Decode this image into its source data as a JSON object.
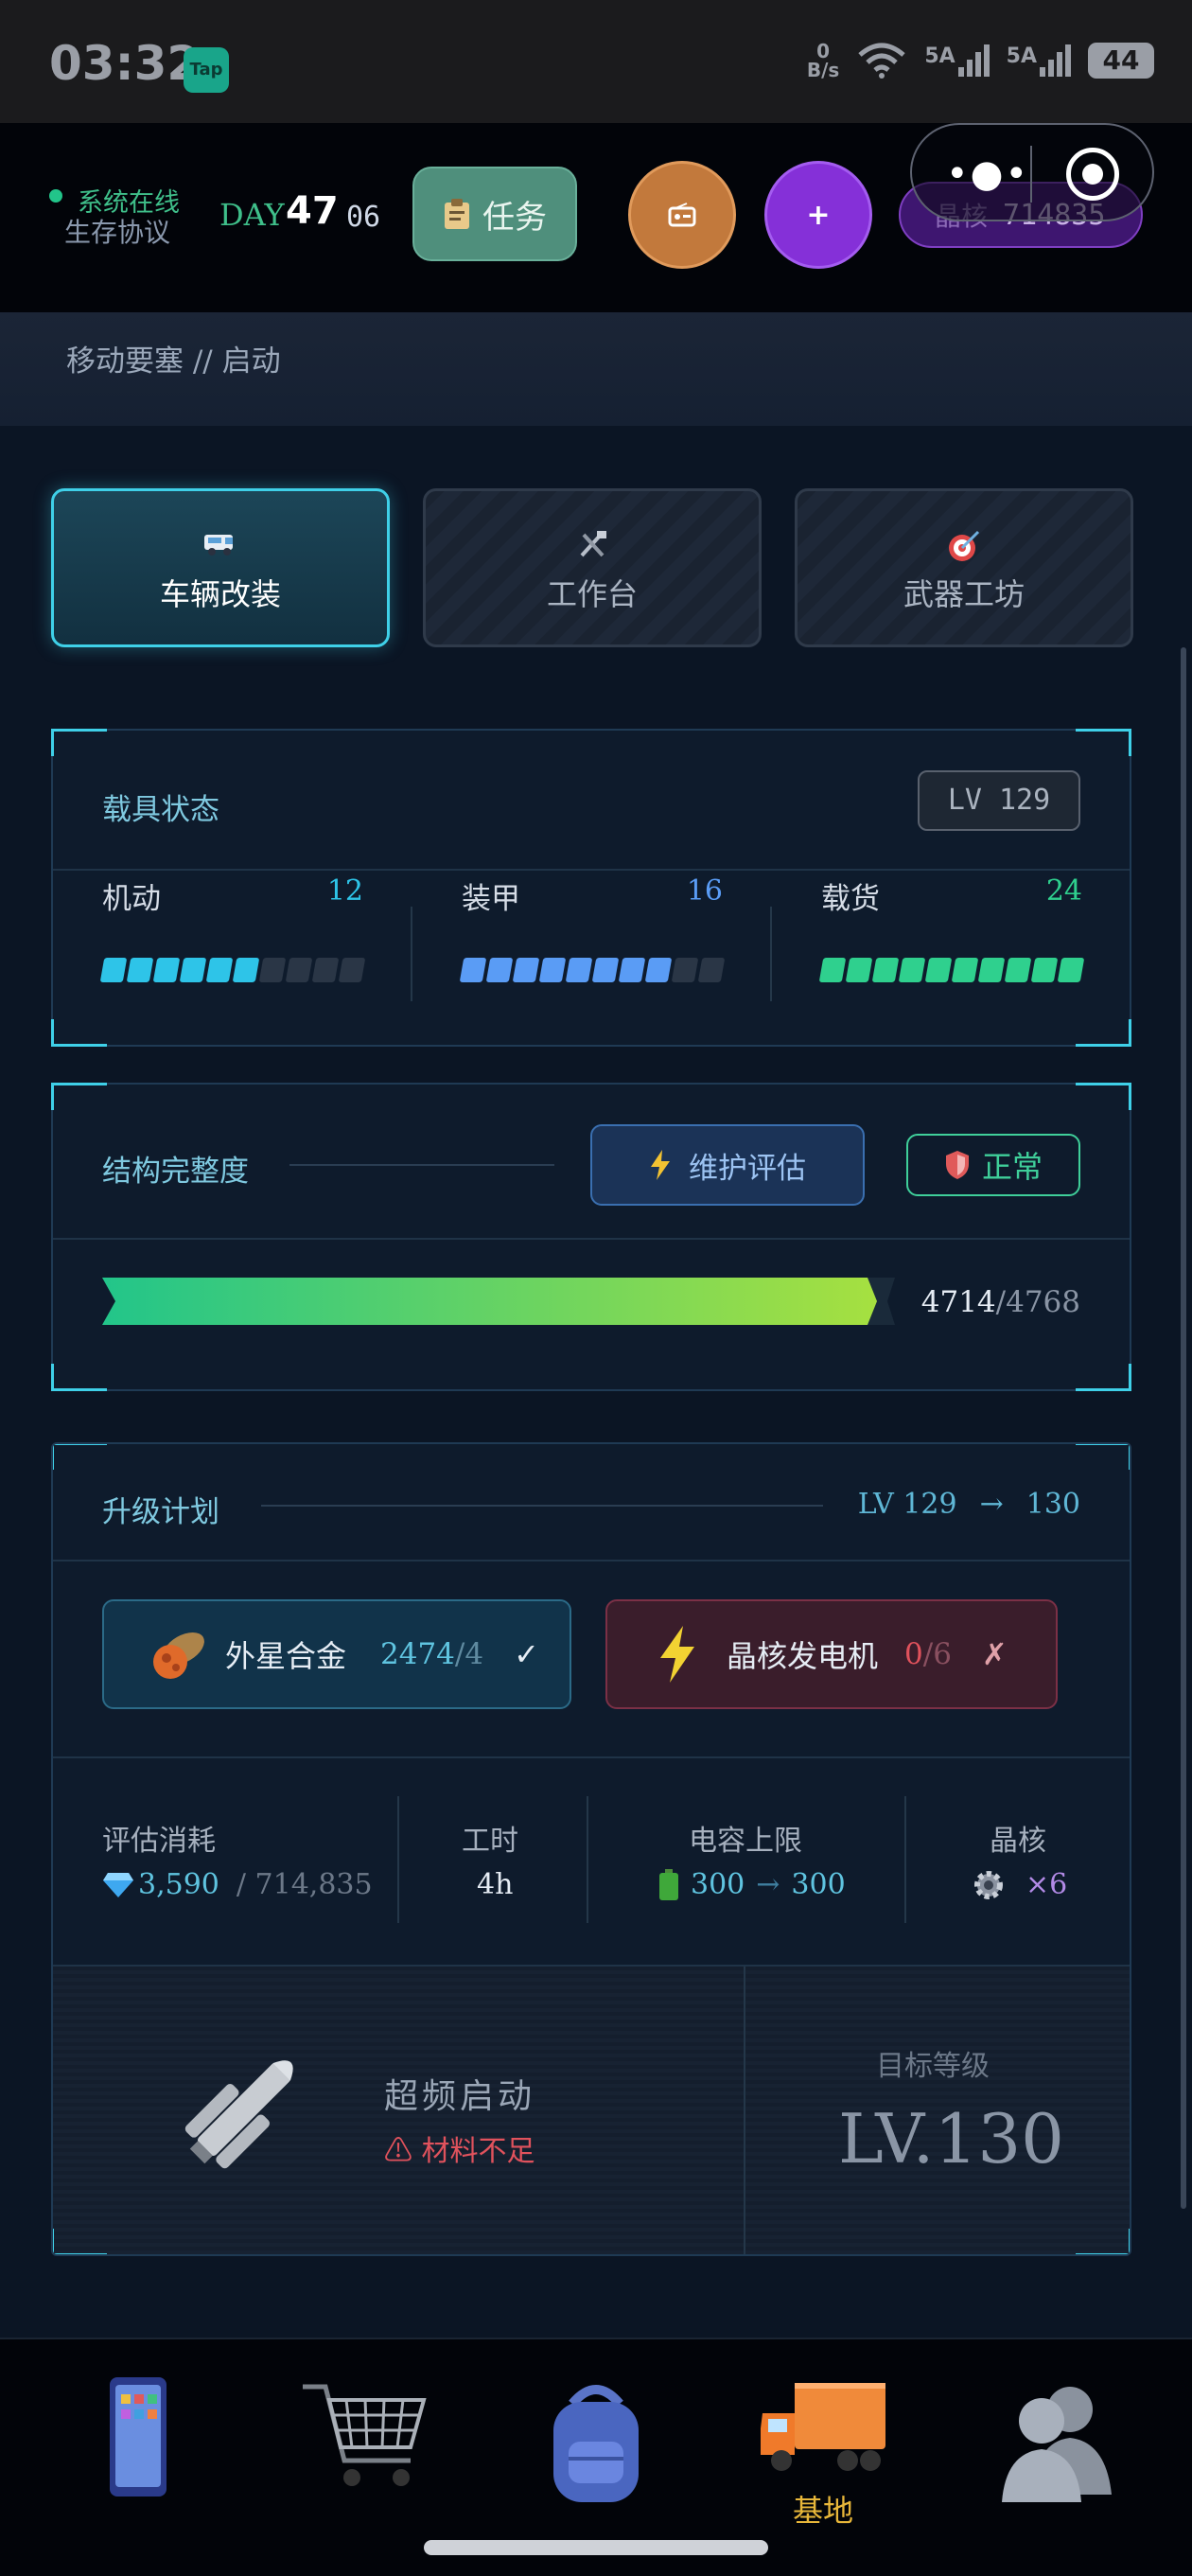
{
  "status_bar": {
    "time": "03:32",
    "app_badge": "Tap",
    "net_speed_value": "0",
    "net_speed_unit": "B/s",
    "signal_1": "5A",
    "signal_2": "5A",
    "battery": "44"
  },
  "header": {
    "system_status": "系统在线",
    "protocol": "生存协议",
    "day_label": "DAY",
    "day_number": "47",
    "day_sub": "06",
    "task_button": "任务",
    "plus_button": "+",
    "crystal_label": "晶核",
    "crystal_value": "714835"
  },
  "banner": {
    "subtitle": "移动要塞 // 启动"
  },
  "tabs": [
    {
      "label": "车辆改装",
      "icon": "van-icon",
      "active": true
    },
    {
      "label": "工作台",
      "icon": "tools-icon",
      "active": false
    },
    {
      "label": "武器工坊",
      "icon": "target-icon",
      "active": false
    }
  ],
  "vehicle_status": {
    "title": "载具状态",
    "level": "LV 129",
    "stats": [
      {
        "name": "机动",
        "value": "12",
        "filled": 6,
        "total": 10,
        "color": "#2ec4e8"
      },
      {
        "name": "装甲",
        "value": "16",
        "filled": 8,
        "total": 10,
        "color": "#5a9cf5"
      },
      {
        "name": "载货",
        "value": "24",
        "filled": 10,
        "total": 10,
        "color": "#2fd08e"
      }
    ]
  },
  "integrity": {
    "title": "结构完整度",
    "maintain_button": "维护评估",
    "status": "正常",
    "current": "4714",
    "max": "/4768",
    "fraction": 0.9886
  },
  "upgrade": {
    "title": "升级计划",
    "from_level": "LV 129",
    "arrow": "→",
    "to_level": "130",
    "requirements": [
      {
        "name": "外星合金",
        "have": "2474",
        "need": "/4",
        "mark": "✓",
        "ok": true
      },
      {
        "name": "晶核发电机",
        "have": "0",
        "need": "/6",
        "mark": "✗",
        "ok": false
      }
    ],
    "costs": {
      "estimate_label": "评估消耗",
      "estimate_value": "3,590",
      "estimate_total": "/ 714,835",
      "time_label": "工时",
      "time_value": "4h",
      "capacity_label": "电容上限",
      "capacity_from": "300",
      "capacity_arrow": "→",
      "capacity_to": "300",
      "core_label": "晶核",
      "core_value": "×6"
    },
    "launch_title": "超频启动",
    "launch_warning": "⚠ 材料不足",
    "target_label": "目标等级",
    "target_value": "LV.130"
  },
  "nav": {
    "active_label": "基地"
  },
  "colors": {
    "accent": "#3fd0e8",
    "success": "#3fcf9a",
    "danger": "#e0525c",
    "gold": "#e8b73a"
  }
}
